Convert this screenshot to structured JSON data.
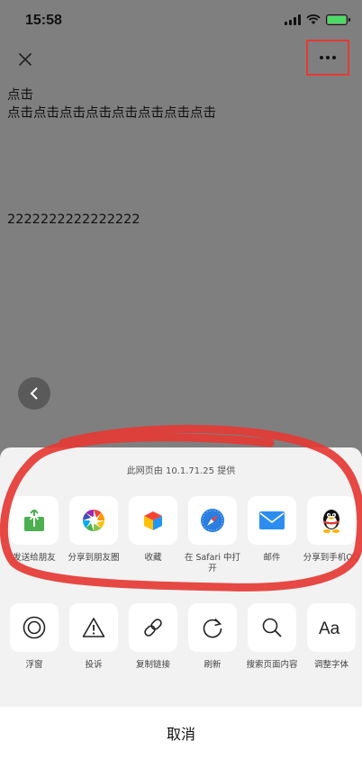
{
  "status_bar": {
    "time": "15:58"
  },
  "nav": {
    "close_icon": "close-icon",
    "more_icon": "ellipsis-icon"
  },
  "content": {
    "line1": "点击",
    "line2": "点击点击点击点击点击点击点击点击",
    "line3": "2222222222222222"
  },
  "sheet": {
    "provider": "此网页由 10.1.71.25 提供",
    "row1": [
      {
        "label": "发送给朋友",
        "icon": "share-to-friend-icon"
      },
      {
        "label": "分享到朋友圈",
        "icon": "moments-icon"
      },
      {
        "label": "收藏",
        "icon": "favorite-cube-icon"
      },
      {
        "label": "在 Safari 中打开",
        "icon": "safari-compass-icon"
      },
      {
        "label": "邮件",
        "icon": "mail-icon"
      },
      {
        "label": "分享到手机QQ",
        "icon": "qq-penguin-icon"
      }
    ],
    "row2": [
      {
        "label": "浮窗",
        "icon": "floating-window-icon"
      },
      {
        "label": "投诉",
        "icon": "warning-icon"
      },
      {
        "label": "复制链接",
        "icon": "link-icon"
      },
      {
        "label": "刷新",
        "icon": "refresh-icon"
      },
      {
        "label": "搜索页面内容",
        "icon": "search-icon"
      },
      {
        "label": "调整字体",
        "icon": "font-size-icon"
      }
    ],
    "cancel_label": "取消"
  },
  "colors": {
    "annotation_red": "#e53935",
    "share_green": "#4caf50",
    "mail_blue": "#2d8cf0",
    "safari_blue": "#2a7de1"
  }
}
